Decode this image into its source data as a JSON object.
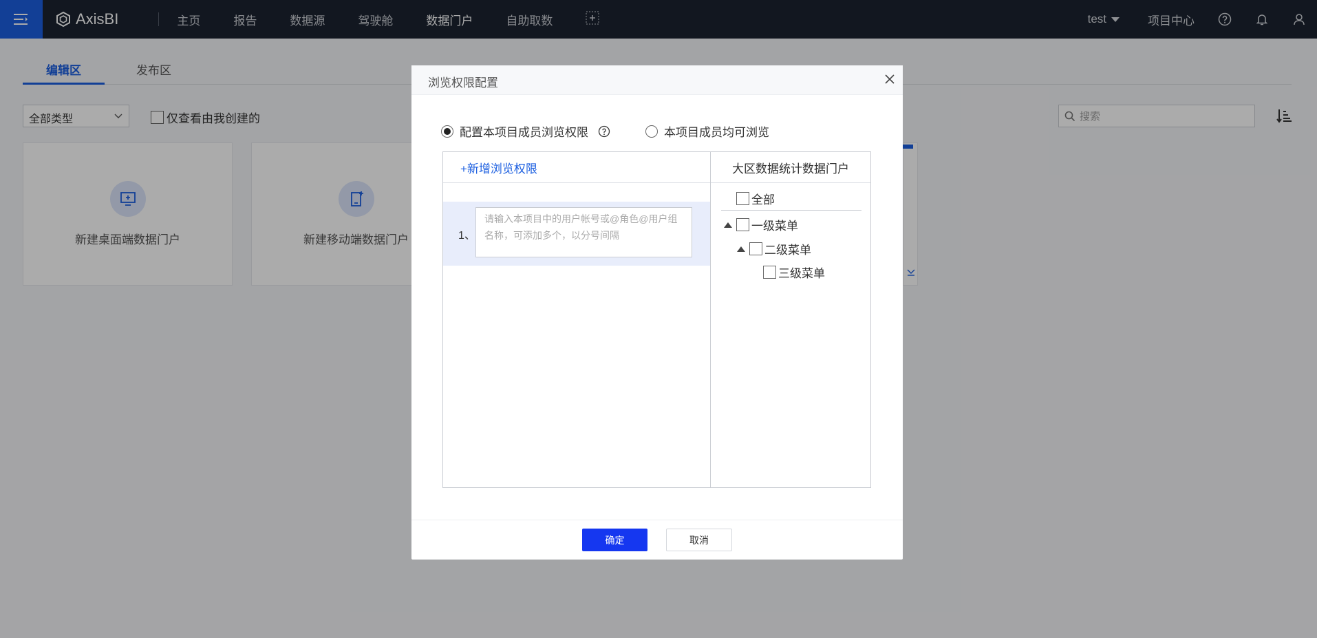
{
  "app": {
    "name": "AxisBI"
  },
  "nav": {
    "items": [
      {
        "label": "主页"
      },
      {
        "label": "报告"
      },
      {
        "label": "数据源"
      },
      {
        "label": "驾驶舱"
      },
      {
        "label": "数据门户"
      },
      {
        "label": "自助取数"
      }
    ],
    "active": "数据门户",
    "user": "test",
    "project_center": "项目中心"
  },
  "page": {
    "tabs": [
      {
        "label": "编辑区"
      },
      {
        "label": "发布区"
      }
    ],
    "type_select": "全部类型",
    "mine_only": "仅查看由我创建的",
    "search_placeholder": "搜索",
    "cards": [
      {
        "label": "新建桌面端数据门户"
      },
      {
        "label": "新建移动端数据门户"
      }
    ]
  },
  "modal": {
    "title": "浏览权限配置",
    "radio_config": "配置本项目成员浏览权限",
    "radio_all": "本项目成员均可浏览",
    "add_permission": "+新增浏览权限",
    "row_number": "1、",
    "input_placeholder": "请输入本项目中的用户帐号或@角色@用户组名称，可添加多个，以分号间隔",
    "tree_header": "大区数据统计数据门户",
    "tree": {
      "all": "全部",
      "level1": "一级菜单",
      "level2": "二级菜单",
      "level3": "三级菜单"
    },
    "confirm": "确定",
    "cancel": "取消"
  },
  "colors": {
    "accent": "#1c5fe0",
    "primary_button": "#1537f0",
    "topbar": "#1b2331"
  }
}
